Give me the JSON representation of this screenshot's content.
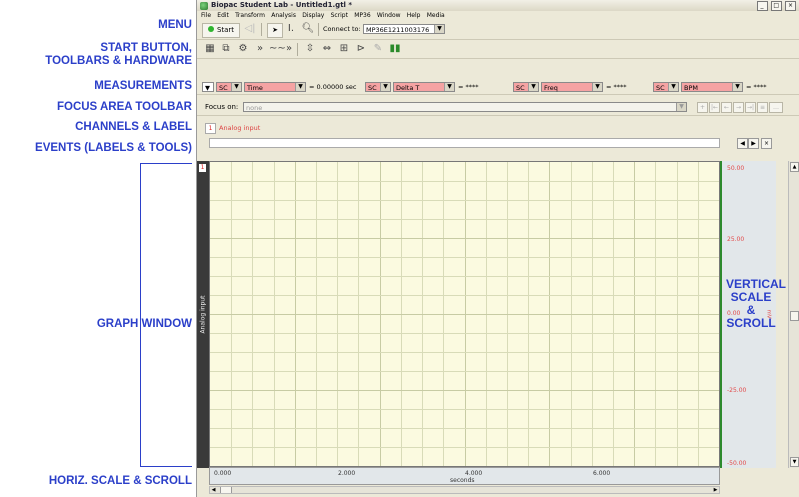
{
  "annotations": {
    "menu": "MENU",
    "start_line1": "START BUTTON,",
    "start_line2": "TOOLBARS & HARDWARE",
    "measurements": "MEASUREMENTS",
    "focus": "FOCUS AREA TOOLBAR",
    "channels": "CHANNELS & LABEL",
    "events": "EVENTS (LABELS & TOOLS)",
    "graph": "GRAPH WINDOW",
    "horiz": "HORIZ. SCALE & SCROLL",
    "vert_line1": "VERTICAL",
    "vert_line2": "SCALE",
    "vert_line3": "&",
    "vert_line4": "SCROLL"
  },
  "window": {
    "title": "Biopac Student Lab - Untitled1.gtl *",
    "controls": [
      "_",
      "□",
      "×"
    ]
  },
  "menu": [
    "File",
    "Edit",
    "Transform",
    "Analysis",
    "Display",
    "Script",
    "MP36",
    "Window",
    "Help",
    "Media"
  ],
  "toolbar": {
    "start_label": "Start",
    "connect_label": "Connect to:",
    "connect_value": "MP36E1211003176"
  },
  "measurements": [
    {
      "channel": "SC",
      "type": "Time",
      "value": "0.00000 sec"
    },
    {
      "channel": "SC",
      "type": "Delta T",
      "value": "****"
    },
    {
      "channel": "SC",
      "type": "Freq",
      "value": "****"
    },
    {
      "channel": "SC",
      "type": "BPM",
      "value": "****"
    }
  ],
  "focus": {
    "label": "Focus on:",
    "value": "none"
  },
  "channel": {
    "number": "1",
    "label": "Analog input"
  },
  "graph": {
    "channel_marker": "1",
    "axis_label": "Analog input",
    "grid_color": "#d8dbb8",
    "background": "#fbfae0"
  },
  "vscale": {
    "ticks": [
      "50.00",
      "25.00",
      "0.00",
      "-25.00",
      "-50.00"
    ],
    "unit": "mV"
  },
  "hscale": {
    "ticks": [
      "0.000",
      "2.000",
      "4.000",
      "6.000"
    ],
    "unit": "seconds"
  }
}
